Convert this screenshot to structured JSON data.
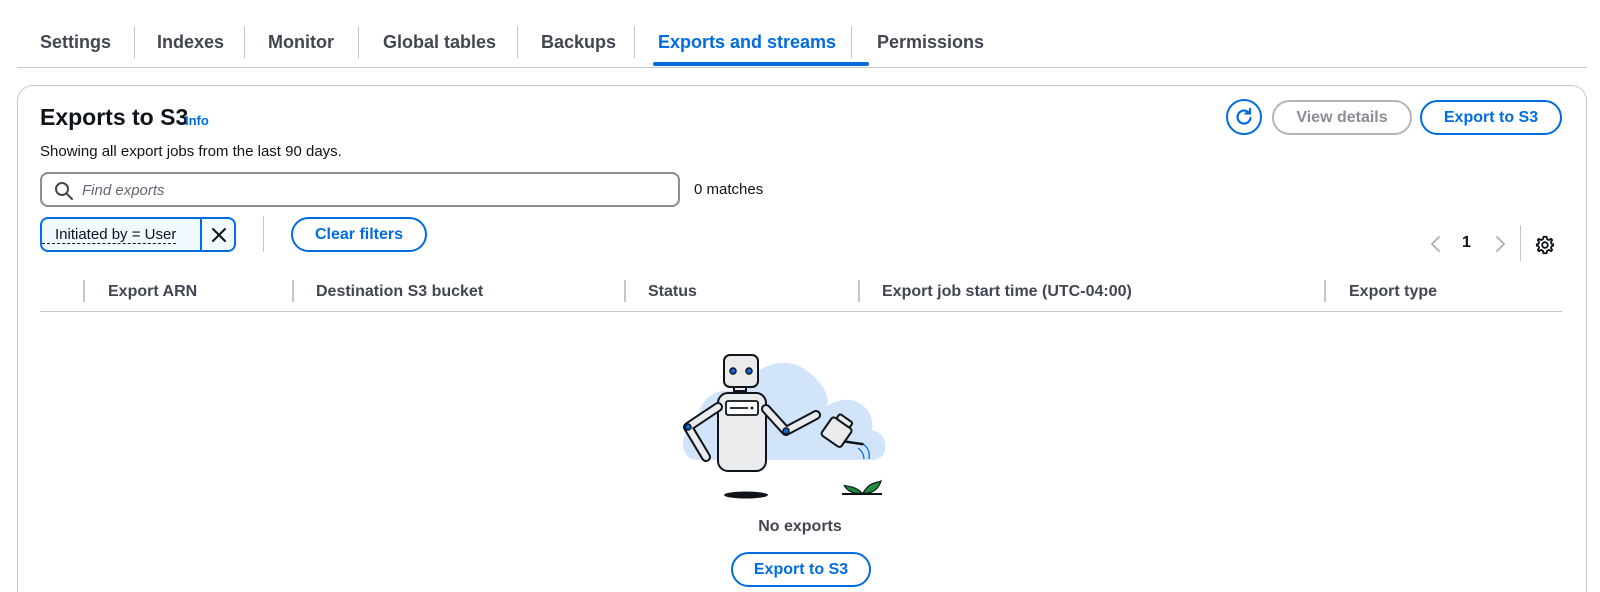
{
  "tabs": [
    {
      "label": "Settings"
    },
    {
      "label": "Indexes"
    },
    {
      "label": "Monitor"
    },
    {
      "label": "Global tables"
    },
    {
      "label": "Backups"
    },
    {
      "label": "Exports and streams",
      "active": true
    },
    {
      "label": "Permissions"
    }
  ],
  "header": {
    "title": "Exports to S3",
    "info": "Info",
    "description": "Showing all export jobs from the last 90 days.",
    "view_details": "View details",
    "export_to_s3": "Export to S3"
  },
  "search": {
    "placeholder": "Find exports",
    "value": "",
    "matches": "0 matches"
  },
  "filter": {
    "token": "Initiated by = User",
    "clear_filters": "Clear filters"
  },
  "pagination": {
    "current_page": "1"
  },
  "table": {
    "columns": [
      "Export ARN",
      "Destination S3 bucket",
      "Status",
      "Export job start time (UTC-04:00)",
      "Export type"
    ]
  },
  "empty_state": {
    "title": "No exports",
    "action": "Export to S3"
  },
  "colors": {
    "accent": "#006ce0",
    "text": "#0f141a",
    "muted": "#424650",
    "border": "#c6c6cd"
  }
}
